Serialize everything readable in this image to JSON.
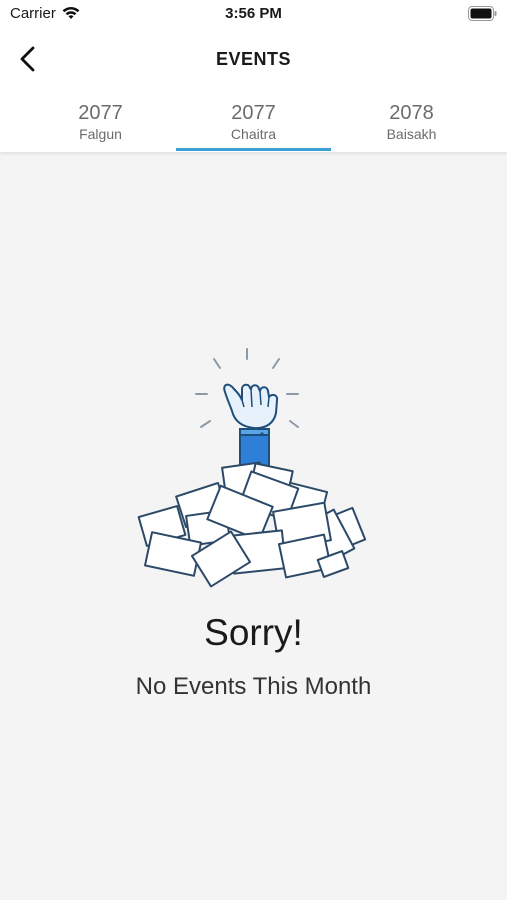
{
  "status_bar": {
    "carrier": "Carrier",
    "time": "3:56 PM"
  },
  "header": {
    "title": "EVENTS"
  },
  "tabs": [
    {
      "year": "2077",
      "month": "Falgun",
      "selected": false
    },
    {
      "year": "2077",
      "month": "Chaitra",
      "selected": true
    },
    {
      "year": "2078",
      "month": "Baisakh",
      "selected": false
    }
  ],
  "empty_state": {
    "title": "Sorry!",
    "message": "No Events This Month"
  },
  "colors": {
    "accent": "#3a9fd4",
    "background": "#f4f4f4",
    "paper_outline": "#3a5a7a",
    "sleeve": "#2f7fd8"
  },
  "icons": [
    "wifi-icon",
    "battery-icon",
    "back-chevron-icon",
    "empty-events-illustration"
  ]
}
